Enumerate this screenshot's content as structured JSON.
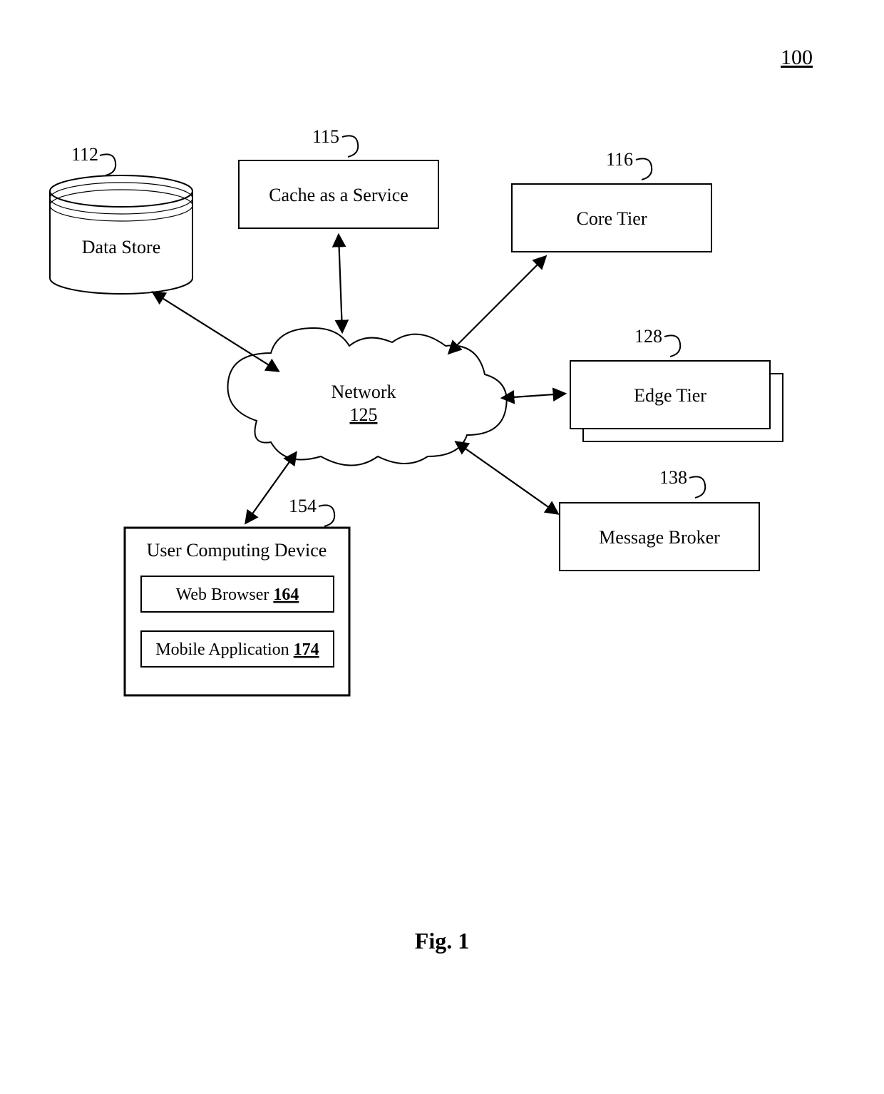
{
  "figure_number": "100",
  "caption": "Fig. 1",
  "nodes": {
    "data_store": {
      "ref": "112",
      "label": "Data Store"
    },
    "cache": {
      "ref": "115",
      "label": "Cache as a Service"
    },
    "core_tier": {
      "ref": "116",
      "label": "Core Tier"
    },
    "network": {
      "ref": "125",
      "label": "Network"
    },
    "edge_tier": {
      "ref": "128",
      "label": "Edge Tier"
    },
    "msg_broker": {
      "ref": "138",
      "label": "Message Broker"
    },
    "user_device": {
      "ref": "154",
      "label": "User Computing Device"
    },
    "web_browser": {
      "ref": "164",
      "label": "Web Browser"
    },
    "mobile_app": {
      "ref": "174",
      "label": "Mobile Application"
    }
  }
}
